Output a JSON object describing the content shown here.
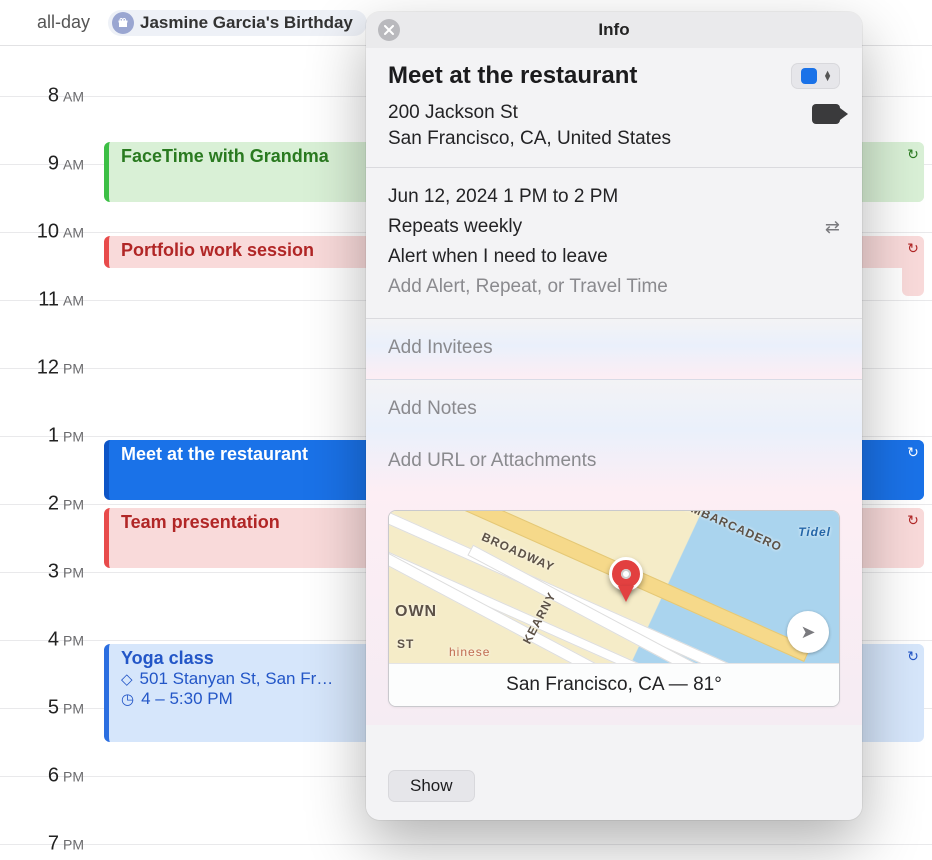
{
  "allday_label": "all-day",
  "allday_event": "Jasmine Garcia's Birthday",
  "hours": [
    {
      "num": "8",
      "ampm": "AM"
    },
    {
      "num": "9",
      "ampm": "AM"
    },
    {
      "num": "10",
      "ampm": "AM"
    },
    {
      "num": "11",
      "ampm": "AM"
    },
    {
      "num": "12",
      "ampm": "PM"
    },
    {
      "num": "1",
      "ampm": "PM"
    },
    {
      "num": "2",
      "ampm": "PM"
    },
    {
      "num": "3",
      "ampm": "PM"
    },
    {
      "num": "4",
      "ampm": "PM"
    },
    {
      "num": "5",
      "ampm": "PM"
    },
    {
      "num": "6",
      "ampm": "PM"
    },
    {
      "num": "7",
      "ampm": "PM"
    }
  ],
  "events": {
    "facetime": {
      "title": "FaceTime with Grandma"
    },
    "portfolio": {
      "title": "Portfolio work session"
    },
    "meet": {
      "title": "Meet at the restaurant"
    },
    "team": {
      "title": "Team presentation"
    },
    "yoga": {
      "title": "Yoga class",
      "location": "501 Stanyan St, San Fr…",
      "time": "4 – 5:30 PM"
    }
  },
  "popover": {
    "header": "Info",
    "title": "Meet at the restaurant",
    "location_line1": "200 Jackson St",
    "location_line2": "San Francisco, CA, United States",
    "datetime": "Jun 12, 2024  1 PM to 2 PM",
    "repeat": "Repeats weekly",
    "alert": "Alert when I need to leave",
    "add_alert": "Add Alert, Repeat, or Travel Time",
    "add_invitees": "Add Invitees",
    "add_notes": "Add Notes",
    "add_url": "Add URL or Attachments",
    "map_footer": "San Francisco, CA — 81°",
    "show": "Show",
    "calendar_color": "#1a72e8",
    "streets": {
      "broadway": "BROADWAY",
      "embarcadero": "EMBARCADERO",
      "kearny": "KEARNY",
      "town": "OWN",
      "st": "ST",
      "tidel": "Tidel",
      "chinese": "hinese"
    }
  }
}
